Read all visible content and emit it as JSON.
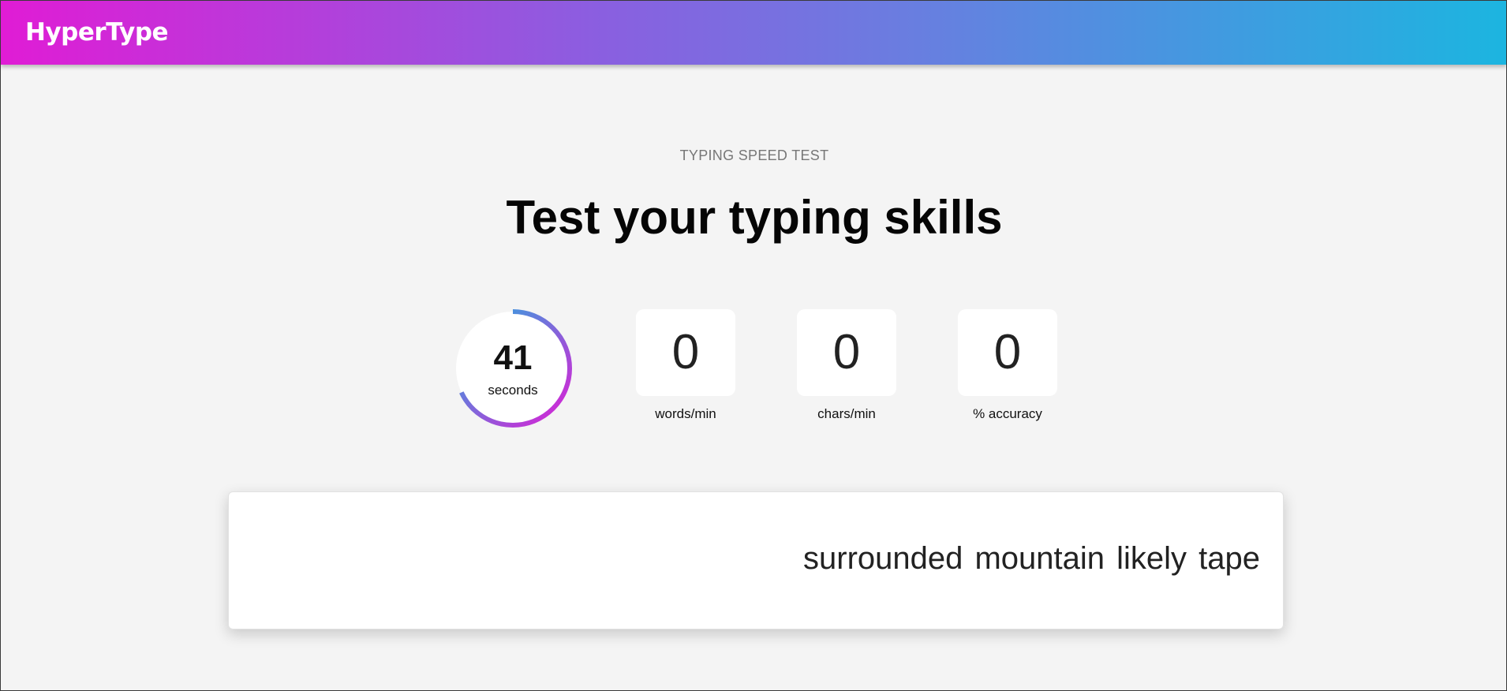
{
  "header": {
    "logo": "HyperType",
    "gradient_start": "#e01cd5",
    "gradient_end": "#1cb5e0"
  },
  "hero": {
    "subtitle": "TYPING SPEED TEST",
    "title": "Test your typing skills"
  },
  "timer": {
    "value": "41",
    "unit": "seconds",
    "remaining_fraction": 0.68,
    "ring_colors": [
      "#e01cd5",
      "#1cb5e0"
    ]
  },
  "stats": [
    {
      "value": "0",
      "label": "words/min"
    },
    {
      "value": "0",
      "label": "chars/min"
    },
    {
      "value": "0",
      "label": "% accuracy"
    }
  ],
  "typing_area": {
    "text": "surrounded mountain likely tape"
  }
}
